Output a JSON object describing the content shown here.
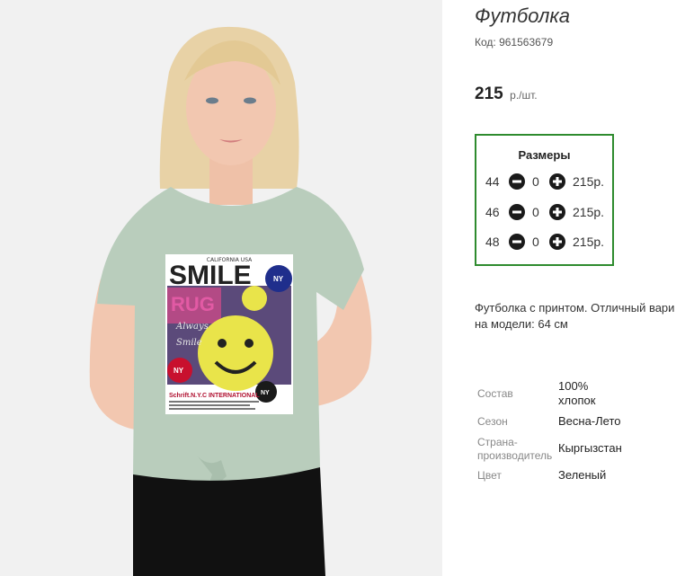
{
  "product": {
    "title": "Футболка",
    "code": "Код: 961563679",
    "price_value": "215",
    "price_unit": "р./шт."
  },
  "sizes": {
    "title": "Размеры",
    "rows": [
      {
        "size": "44",
        "qty": "0",
        "sum": "215р."
      },
      {
        "size": "46",
        "qty": "0",
        "sum": "215р."
      },
      {
        "size": "48",
        "qty": "0",
        "sum": "215р."
      }
    ]
  },
  "description": {
    "line1": "Футболка с принтом. Отличный вари",
    "line2": "на модели: 64 см"
  },
  "properties": [
    {
      "label": "Состав",
      "value_line1": "100%",
      "value_line2": "хлопок"
    },
    {
      "label": "Сезон",
      "value_line1": "Весна-Лето"
    },
    {
      "label_line1": "Страна-",
      "label_line2": "производитель",
      "value_line1": "Кыргызстан"
    },
    {
      "label": "Цвет",
      "value_line1": "Зеленый"
    }
  ],
  "image": {
    "print_top": "CALIFORNIA USA",
    "print_smile": "SMILE",
    "print_rug": "RUG",
    "print_script1": "Always",
    "print_script2": "Smile",
    "print_badge": "NY",
    "print_brand": "Schrift.N.Y.C INTERNATIONAL",
    "colors": {
      "background": "#f1f1f1",
      "shirt": "#b9cdbc",
      "skin": "#f2c7b0",
      "hair": "#e8d2a6",
      "pants": "#111111",
      "smiley": "#e9e44a",
      "badge_red": "#c8102e",
      "accent_green": "#2e8b2e"
    }
  }
}
